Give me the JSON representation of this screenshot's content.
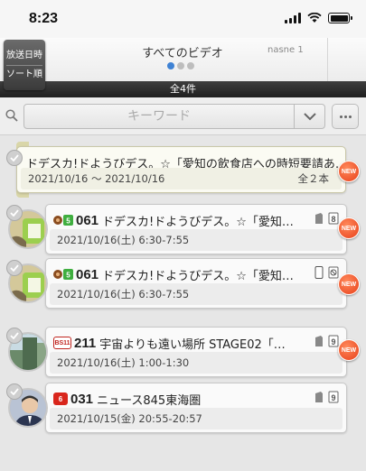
{
  "status_bar": {
    "time": "8:23"
  },
  "header": {
    "sort_button": {
      "line1": "放送日時",
      "line2": "ソート順"
    },
    "title": "すべてのビデオ",
    "next_title": "nasne 1",
    "count": "全4件"
  },
  "search": {
    "placeholder": "キーワード"
  },
  "items": [
    {
      "type": "folder",
      "title": "ドデスカ!ドようびデス。☆「愛知の飲食店への時短要請あ…",
      "date": "2021/10/16 ～ 2021/10/16",
      "count": "全２本",
      "badge": "NEW"
    },
    {
      "type": "program",
      "channel": "061",
      "title": "ドデスカ!ドようびデス。☆「愛知…",
      "date": "2021/10/16(土) 6:30-7:55",
      "badge": "NEW"
    },
    {
      "type": "program",
      "channel": "061",
      "title": "ドデスカ!ドようびデス。☆「愛知…",
      "date": "2021/10/16(土) 6:30-7:55",
      "badge": "NEW"
    },
    {
      "type": "program",
      "channel": "211",
      "channel_logo": "BS11",
      "title": "宇宙よりも遠い場所 STAGE02「…",
      "date": "2021/10/16(土) 1:00-1:30",
      "badge": "NEW"
    },
    {
      "type": "program",
      "channel": "031",
      "channel_logo": "6",
      "title": "ニュース845東海圏",
      "date": "2021/10/15(金) 20:55-20:57"
    }
  ],
  "colors": {
    "accent": "#3f82d4",
    "new_badge": "#e8401a",
    "count_bar": "#2a2a2a"
  }
}
